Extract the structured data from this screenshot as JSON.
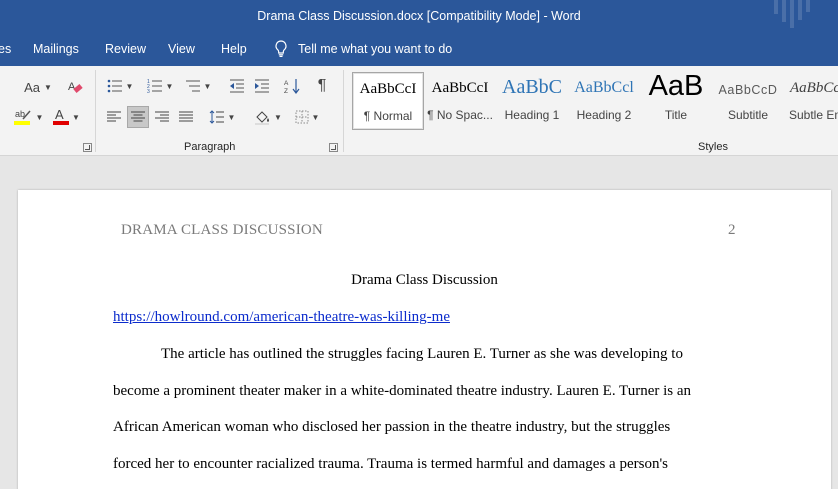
{
  "window": {
    "title": "Drama Class Discussion.docx [Compatibility Mode]  -  Word"
  },
  "tabs": {
    "references_partial": "es",
    "mailings": "Mailings",
    "review": "Review",
    "view": "View",
    "help": "Help",
    "tell_me": "Tell me what you want to do"
  },
  "ribbon": {
    "font_size_label": "Aa",
    "paragraph_group": "Paragraph",
    "styles_group": "Styles",
    "styles": [
      {
        "sample": "AaBbCcI",
        "name": "¶ Normal"
      },
      {
        "sample": "AaBbCcI",
        "name": "¶ No Spac..."
      },
      {
        "sample": "AaBbC",
        "name": "Heading 1"
      },
      {
        "sample": "AaBbCcl",
        "name": "Heading 2"
      },
      {
        "sample": "AaB",
        "name": "Title"
      },
      {
        "sample": "AaBbCcD",
        "name": "Subtitle"
      },
      {
        "sample": "AaBbCcI",
        "name": "Subtle Em"
      }
    ],
    "colors": {
      "highlight": "#ffff00",
      "font_color": "#e00000"
    }
  },
  "document": {
    "running_head": "DRAMA CLASS DISCUSSION",
    "page_number": "2",
    "title": "Drama Class Discussion",
    "link": "https://howlround.com/american-theatre-was-killing-me",
    "lines": [
      "The article has outlined the struggles facing Lauren E. Turner as she was developing to",
      "become a prominent theater maker in a white-dominated theatre industry. Lauren E. Turner is an",
      "African American woman who disclosed her passion in the theatre industry, but the struggles",
      "forced her to encounter racialized trauma. Trauma is termed harmful and damages a person's"
    ]
  },
  "colors": {
    "word_blue": "#2b579a",
    "link": "#0b2bcc"
  }
}
